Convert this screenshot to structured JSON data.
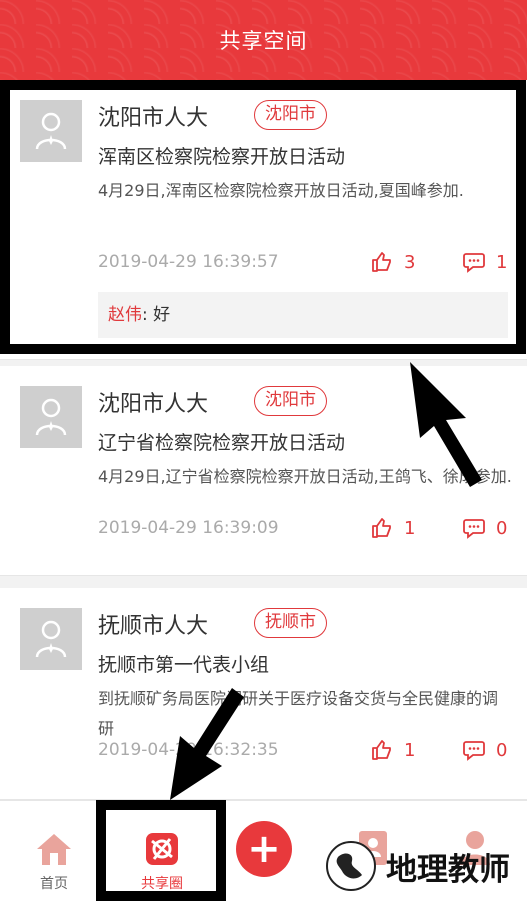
{
  "header": {
    "title": "共享空间"
  },
  "posts": [
    {
      "author": "沈阳市人大",
      "region": "沈阳市",
      "title": "浑南区检察院检察开放日活动",
      "body": "4月29日,浑南区检察院检察开放日活动,夏国峰参加.",
      "time": "2019-04-29 16:39:57",
      "likes": "3",
      "comments": "1",
      "comment_list": [
        {
          "user": "赵伟",
          "sep": ":",
          "text": "好"
        }
      ]
    },
    {
      "author": "沈阳市人大",
      "region": "沈阳市",
      "title": "辽宁省检察院检察开放日活动",
      "body": "4月29日,辽宁省检察院检察开放日活动,王鸽飞、徐成参加.",
      "time": "2019-04-29 16:39:09",
      "likes": "1",
      "comments": "0"
    },
    {
      "author": "抚顺市人大",
      "region": "抚顺市",
      "title": "抚顺市第一代表小组",
      "body": "到抚顺矿务局医院调研关于医疗设备交货与全民健康的调研",
      "time": "2019-04-29 16:32:35",
      "likes": "1",
      "comments": "0"
    }
  ],
  "nav": {
    "home": "首页",
    "share": "共享圈",
    "add": "+",
    "active_color": "#e8393c",
    "inactive_color": "#666666"
  },
  "watermark": {
    "text": "地理教师"
  },
  "colors": {
    "accent": "#e8393c",
    "avatar_bg": "#cfcfcf"
  }
}
